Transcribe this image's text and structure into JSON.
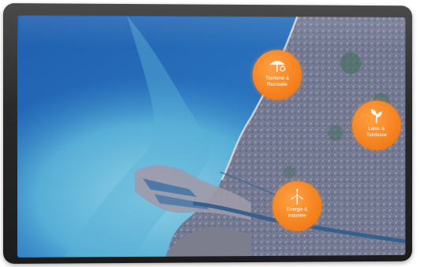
{
  "hotspots": [
    {
      "id": "recreatie",
      "icon": "parasol-icon",
      "line1": "Toerisme &",
      "line2": "Recreatie"
    },
    {
      "id": "tuinbouw",
      "icon": "plant-sprout-icon",
      "line1": "Land- &",
      "line2": "Tuinbouw"
    },
    {
      "id": "industrie",
      "icon": "wind-turbine-icon",
      "line1": "Energie &",
      "line2": "Industrie"
    }
  ],
  "colors": {
    "accent": "#f5821f",
    "sea": "#2b6fb8",
    "shallow_water": "#5fb6d6",
    "land": "#7a7e92",
    "bezel": "#2a2a2a"
  }
}
